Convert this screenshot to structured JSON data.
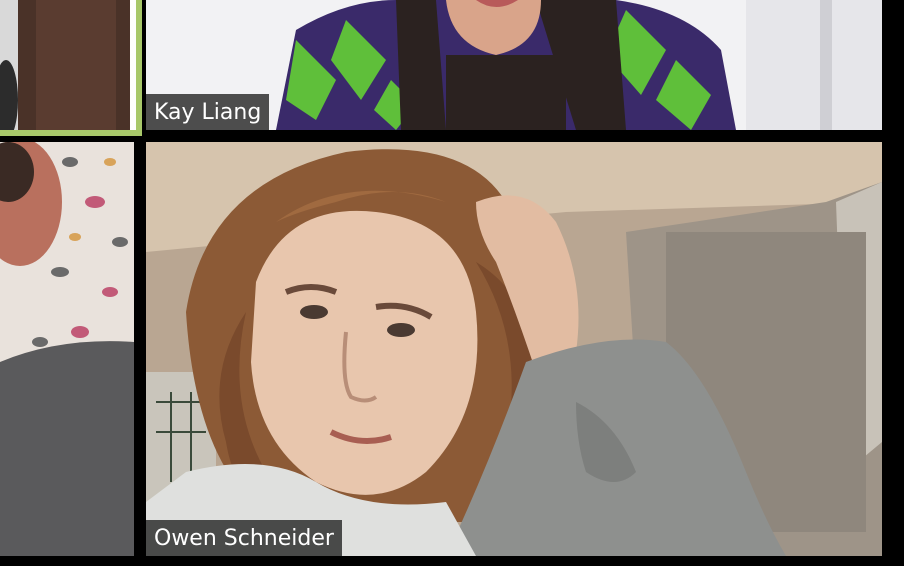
{
  "meeting": {
    "participants": [
      {
        "id": "top-left",
        "name": ""
      },
      {
        "id": "kay",
        "name": "Kay Liang"
      },
      {
        "id": "left-middle",
        "name": ""
      },
      {
        "id": "owen",
        "name": "Owen Schneider"
      }
    ],
    "active_speaker_color": "#a8c86a",
    "label_background": "#282828",
    "label_text_color": "#ffffff"
  }
}
